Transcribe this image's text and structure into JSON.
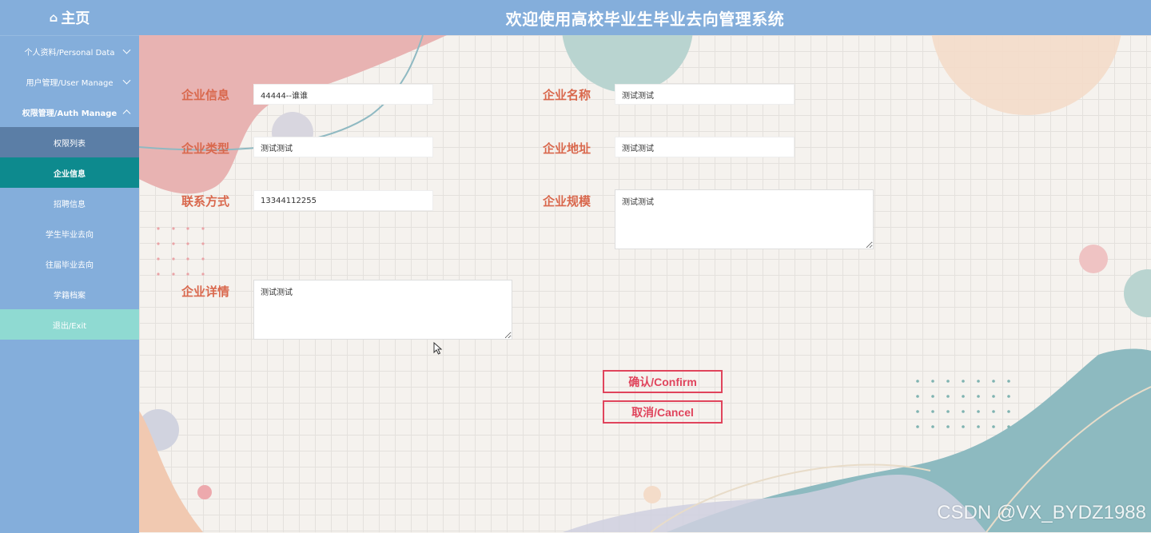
{
  "header": {
    "home_label": "主页",
    "title": "欢迎使用高校毕业生毕业去向管理系统"
  },
  "sidebar": {
    "items": [
      {
        "label": "个人资料/Personal Data"
      },
      {
        "label": "用户管理/User Manage"
      },
      {
        "label": "权限管理/Auth Manage"
      }
    ],
    "sub_items": [
      {
        "label": "权限列表"
      },
      {
        "label": "企业信息"
      },
      {
        "label": "招聘信息"
      },
      {
        "label": "学生毕业去向"
      },
      {
        "label": "往届毕业去向"
      },
      {
        "label": "学籍档案"
      }
    ],
    "exit_label": "退出/Exit"
  },
  "form": {
    "company_info": {
      "label": "企业信息",
      "value": "44444--谁谁"
    },
    "company_name": {
      "label": "企业名称",
      "value": "测试测试"
    },
    "company_type": {
      "label": "企业类型",
      "value": "测试测试"
    },
    "company_address": {
      "label": "企业地址",
      "value": "测试测试"
    },
    "contact": {
      "label": "联系方式",
      "value": "13344112255"
    },
    "company_scale": {
      "label": "企业规模",
      "value": "测试测试"
    },
    "company_detail": {
      "label": "企业详情",
      "value": "测试测试"
    }
  },
  "buttons": {
    "confirm": "确认/Confirm",
    "cancel": "取消/Cancel"
  },
  "watermark": "CSDN @VX_BYDZ1988",
  "colors": {
    "header_bg": "#84aedb",
    "selected_bg": "#0d8a8e",
    "exit_bg": "#8fdad2",
    "label_color": "#d9684d",
    "button_color": "#e0445c"
  }
}
